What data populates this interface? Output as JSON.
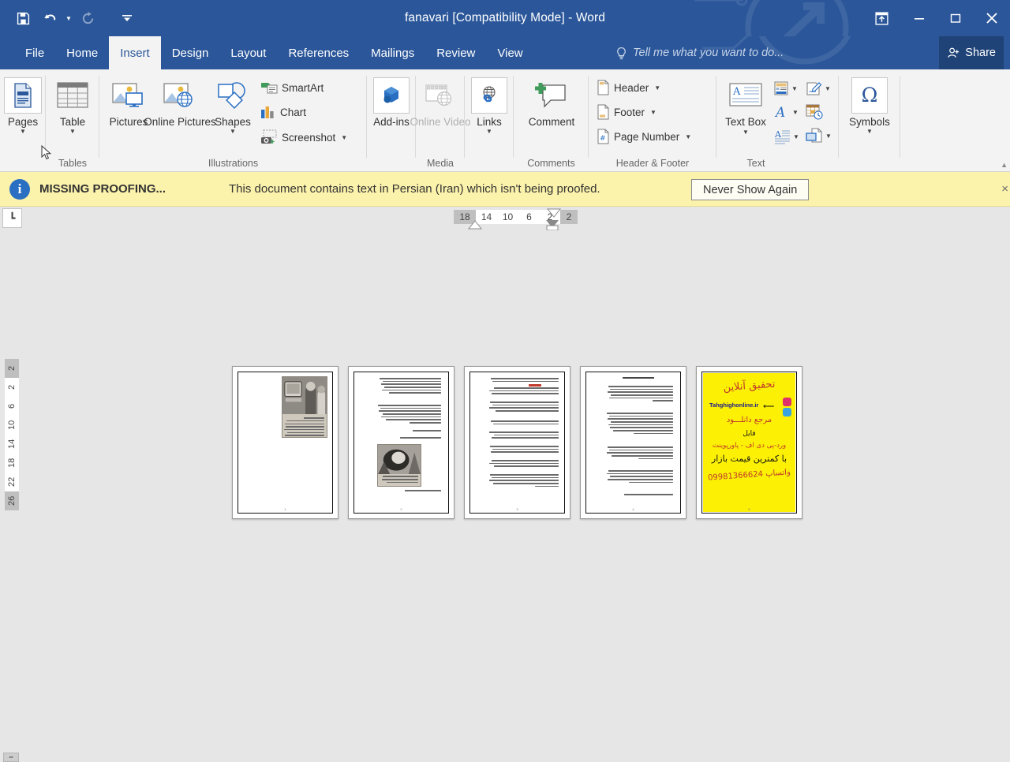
{
  "window": {
    "title": "fanavari [Compatibility Mode] - Word",
    "quick_access": [
      {
        "name": "save-icon",
        "label": "Save",
        "disabled": false
      },
      {
        "name": "undo-icon",
        "label": "Undo",
        "disabled": false
      },
      {
        "name": "redo-icon",
        "label": "Redo",
        "disabled": true
      },
      {
        "name": "customize-qat-icon",
        "label": "Customize Quick Access Toolbar",
        "disabled": false
      }
    ],
    "controls": {
      "ribbon_display_options": "Ribbon Display Options",
      "minimize": "Minimize",
      "restore": "Restore Down",
      "close": "Close"
    }
  },
  "tabs": [
    {
      "label": "File",
      "active": false
    },
    {
      "label": "Home",
      "active": false
    },
    {
      "label": "Insert",
      "active": true
    },
    {
      "label": "Design",
      "active": false
    },
    {
      "label": "Layout",
      "active": false
    },
    {
      "label": "References",
      "active": false
    },
    {
      "label": "Mailings",
      "active": false
    },
    {
      "label": "Review",
      "active": false
    },
    {
      "label": "View",
      "active": false
    }
  ],
  "tell_me": {
    "placeholder": "Tell me what you want to do...",
    "icon": "lightbulb-icon"
  },
  "share": {
    "label": "Share",
    "icon": "person-add-icon"
  },
  "ribbon": {
    "groups": [
      {
        "name": "pages",
        "label": "",
        "items": [
          {
            "label": "Pages",
            "has_dropdown": true,
            "highlighted": true
          }
        ]
      },
      {
        "name": "tables",
        "label": "Tables",
        "items": [
          {
            "label": "Table",
            "has_dropdown": true
          }
        ]
      },
      {
        "name": "illustrations",
        "label": "Illustrations",
        "items": [
          {
            "label": "Pictures",
            "has_dropdown": false
          },
          {
            "label": "Online Pictures",
            "has_dropdown": false
          },
          {
            "label": "Shapes",
            "has_dropdown": true
          },
          {
            "label": "SmartArt",
            "has_dropdown": false
          },
          {
            "label": "Chart",
            "has_dropdown": false
          },
          {
            "label": "Screenshot",
            "has_dropdown": true
          }
        ]
      },
      {
        "name": "add-ins",
        "label": "",
        "items": [
          {
            "label": "Add-ins",
            "has_dropdown": true
          }
        ]
      },
      {
        "name": "media",
        "label": "Media",
        "items": [
          {
            "label": "Online Video",
            "has_dropdown": false,
            "disabled": true
          }
        ]
      },
      {
        "name": "links",
        "label": "",
        "items": [
          {
            "label": "Links",
            "has_dropdown": true
          }
        ]
      },
      {
        "name": "comments",
        "label": "Comments",
        "items": [
          {
            "label": "Comment",
            "has_dropdown": false
          }
        ]
      },
      {
        "name": "header-footer",
        "label": "Header & Footer",
        "items": [
          {
            "label": "Header",
            "has_dropdown": true
          },
          {
            "label": "Footer",
            "has_dropdown": true
          },
          {
            "label": "Page Number",
            "has_dropdown": true
          }
        ]
      },
      {
        "name": "text",
        "label": "Text",
        "items": [
          {
            "label": "Text Box",
            "has_dropdown": true
          },
          {
            "label": "Quick Parts",
            "has_dropdown": true
          },
          {
            "label": "WordArt",
            "has_dropdown": true
          },
          {
            "label": "Drop Cap",
            "has_dropdown": true
          },
          {
            "label": "Signature Line",
            "has_dropdown": true
          },
          {
            "label": "Date & Time",
            "has_dropdown": false
          },
          {
            "label": "Object",
            "has_dropdown": true
          }
        ]
      },
      {
        "name": "symbols",
        "label": "",
        "items": [
          {
            "label": "Symbols",
            "has_dropdown": true,
            "glyph": "Ω"
          }
        ]
      }
    ]
  },
  "notification": {
    "icon": "info-icon",
    "title": "MISSING PROOFING...",
    "message": "This document contains text in Persian (Iran) which isn't being proofed.",
    "button_label": "Never Show Again",
    "close_label": "×",
    "background": "#fbf2ab"
  },
  "rulers": {
    "tab_selector": "┗",
    "horizontal_ticks": [
      "18",
      "14",
      "10",
      "6",
      "2",
      "2"
    ],
    "vertical_ticks": [
      "2",
      "2",
      "6",
      "10",
      "14",
      "18",
      "22",
      "26"
    ]
  },
  "document": {
    "pages": [
      {
        "number": "1",
        "type": "image-page",
        "has_photo": true,
        "photo_caption_lines": 9
      },
      {
        "number": "2",
        "type": "text-image-page",
        "paragraph_lines": [
          6,
          7,
          1,
          1
        ],
        "has_photo": true,
        "caption": true
      },
      {
        "number": "3",
        "type": "bullet-text-page",
        "has_red_highlight": true,
        "paragraph_lines": [
          3,
          3,
          4,
          3,
          2,
          3,
          3,
          3,
          3,
          5
        ]
      },
      {
        "number": "4",
        "type": "text-page",
        "has_title": true,
        "paragraph_lines": [
          6,
          8,
          6,
          5,
          1
        ]
      },
      {
        "number": "5",
        "type": "advertisement",
        "ad": {
          "heading": "تحقیق آنلاین",
          "site": "Tahghighonline.ir",
          "line1": "مرجع دانلـــود",
          "line2": "فایل",
          "line3": "ورد-پی دی اف - پاورپوینت",
          "line4": "با کمترین قیمت بازار",
          "line5": "واتساپ 09981366624",
          "background": "#fcf004"
        }
      }
    ]
  },
  "colors": {
    "title_bar": "#2b579a",
    "ribbon": "#f3f3f3",
    "canvas": "#e6e6e6",
    "notification": "#fbf2ab",
    "accent": "#2b579a"
  }
}
